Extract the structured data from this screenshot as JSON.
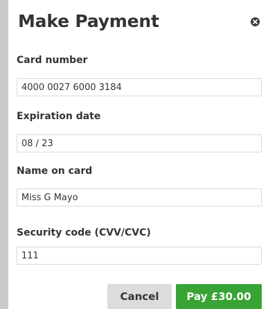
{
  "dialog": {
    "title": "Make Payment",
    "close_icon": "close-circle-icon"
  },
  "fields": {
    "card_number": {
      "label": "Card number",
      "value": "4000 0027 6000 3184"
    },
    "expiration": {
      "label": "Expiration date",
      "value": "08 / 23"
    },
    "name_on_card": {
      "label": "Name on card",
      "value": "Miss G Mayo"
    },
    "security_code": {
      "label": "Security code (CVV/CVC)",
      "value": "111"
    }
  },
  "buttons": {
    "cancel_label": "Cancel",
    "pay_label": "Pay £30.00"
  },
  "colors": {
    "pay_button": "#3aa335",
    "cancel_button": "#dcdcdc",
    "backdrop": "#cacaca"
  }
}
